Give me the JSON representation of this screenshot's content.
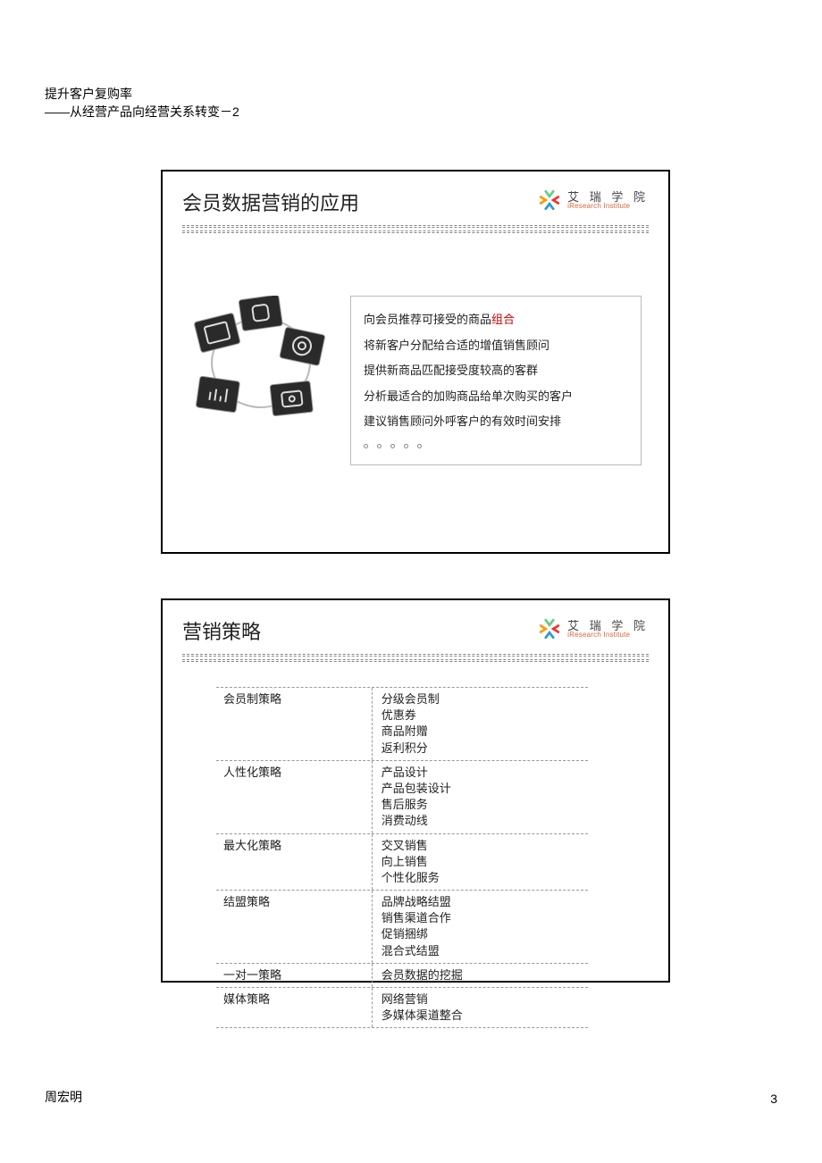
{
  "header": {
    "line1": "提升客户复购率",
    "line2": "——从经营产品向经营关系转变－2"
  },
  "logo": {
    "cn": "艾 瑞 学 院",
    "en": "iResearch Institute"
  },
  "slide1": {
    "title": "会员数据营销的应用",
    "items": [
      {
        "pre": "向会员推荐可接受的商品",
        "hl": "组合",
        "post": ""
      },
      {
        "pre": "将新客户分配给合适的增值销售顾问",
        "hl": "",
        "post": ""
      },
      {
        "pre": "提供新商品匹配接受度较高的客群",
        "hl": "",
        "post": ""
      },
      {
        "pre": "分析最适合的加购商品给单次购买的客户",
        "hl": "",
        "post": ""
      },
      {
        "pre": "建议销售顾问外呼客户的有效时间安排",
        "hl": "",
        "post": ""
      }
    ]
  },
  "slide2": {
    "title": "营销策略",
    "rows": [
      {
        "left": "会员制策略",
        "right": [
          "分级会员制",
          "优惠券",
          "商品附赠",
          "返利积分"
        ]
      },
      {
        "left": "人性化策略",
        "right": [
          "产品设计",
          "产品包装设计",
          "售后服务",
          "消费动线"
        ]
      },
      {
        "left": "最大化策略",
        "right": [
          "交叉销售",
          "向上销售",
          "个性化服务"
        ]
      },
      {
        "left": "结盟策略",
        "right": [
          "品牌战略结盟",
          "销售渠道合作",
          "促销捆绑",
          "混合式结盟"
        ]
      },
      {
        "left": "一对一策略",
        "right": [
          "会员数据的挖掘"
        ]
      },
      {
        "left": "媒体策略",
        "right": [
          "网络营销",
          "多媒体渠道整合"
        ]
      }
    ]
  },
  "footer": {
    "author": "周宏明",
    "page": "3"
  }
}
